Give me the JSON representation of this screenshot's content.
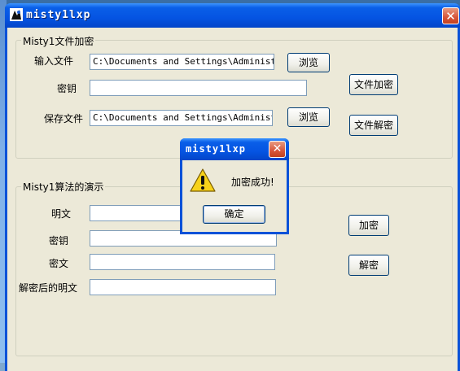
{
  "window": {
    "title": "misty1lxp",
    "close_glyph": "✕"
  },
  "file_group": {
    "label": "Misty1文件加密",
    "input_label": "输入文件",
    "input_value": "C:\\Documents and Settings\\Administrat",
    "browse1_label": "浏览",
    "key_label": "密钥",
    "key_value": "",
    "save_label": "保存文件",
    "save_value": "C:\\Documents and Settings\\Administra",
    "browse2_label": "浏览",
    "encrypt_file_label": "文件加密",
    "decrypt_file_label": "文件解密"
  },
  "demo_group": {
    "label": "Misty1算法的演示",
    "plaintext_label": "明文",
    "plaintext_value": "",
    "key_label": "密钥",
    "key_value": "",
    "ciphertext_label": "密文",
    "ciphertext_value": "",
    "decrypted_label": "解密后的明文",
    "decrypted_value": "",
    "encrypt_label": "加密",
    "decrypt_label": "解密"
  },
  "messagebox": {
    "title": "misty1lxp",
    "close_glyph": "✕",
    "message": "加密成功!",
    "ok_label": "确定",
    "icon": "warning-icon"
  }
}
